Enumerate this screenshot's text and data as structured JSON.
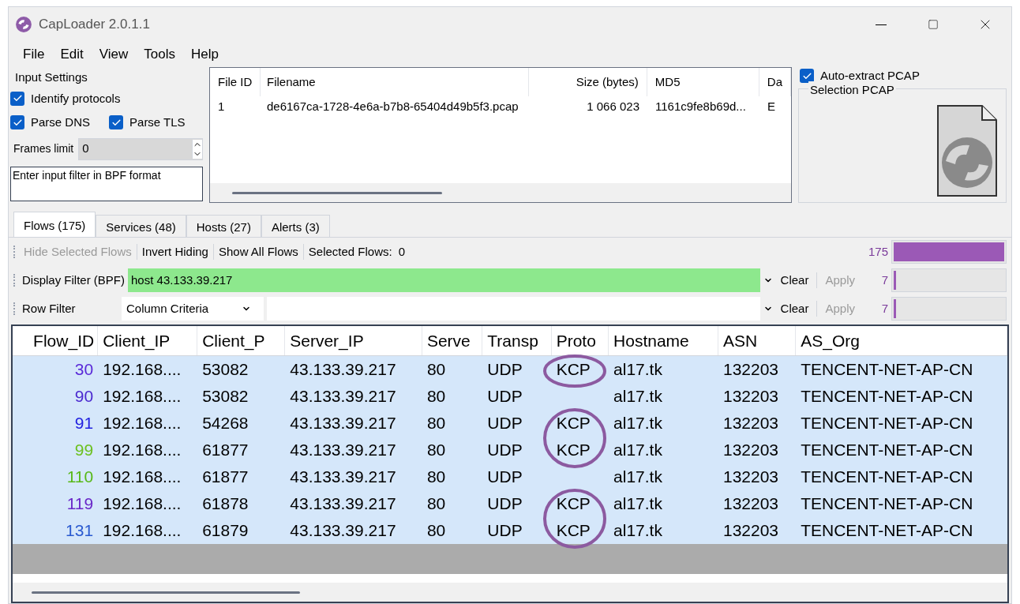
{
  "window": {
    "title": "CapLoader 2.0.1.1"
  },
  "menu": [
    "File",
    "Edit",
    "View",
    "Tools",
    "Help"
  ],
  "input_settings": {
    "title": "Input Settings",
    "checkboxes": [
      {
        "label": "Identify protocols",
        "checked": true
      },
      {
        "label": "Parse DNS",
        "checked": true
      },
      {
        "label": "Parse TLS",
        "checked": true
      }
    ],
    "frames_limit": {
      "label": "Frames limit",
      "value": "0"
    },
    "filter": {
      "placeholder": "Enter input filter in BPF format"
    }
  },
  "files": {
    "columns": [
      "File ID",
      "Filename",
      "Size (bytes)",
      "MD5",
      "Da"
    ],
    "rows": [
      [
        "1",
        "de6167ca-1728-4e6a-b7b8-65404d49b5f3.pcap",
        "1 066 023",
        "1161c9fe8b69d...",
        "E"
      ]
    ]
  },
  "auto_extract": {
    "label": "Auto-extract PCAP",
    "checked": true
  },
  "selection": {
    "title": "Selection PCAP"
  },
  "tabs": [
    {
      "label": "Flows (175)",
      "selected": true
    },
    {
      "label": "Services (48)",
      "selected": false
    },
    {
      "label": "Hosts (27)",
      "selected": false
    },
    {
      "label": "Alerts (3)",
      "selected": false
    }
  ],
  "toolbar": {
    "buttons": [
      {
        "label": "Hide Selected Flows",
        "disabled": true
      },
      {
        "label": "Invert Hiding",
        "disabled": false
      },
      {
        "label": "Show All Flows",
        "disabled": false
      }
    ],
    "selected_label": "Selected Flows:",
    "selected_count": "0",
    "count": "175",
    "level": 1
  },
  "display_filter": {
    "label": "Display Filter (BPF)",
    "value": "host 43.133.39.217",
    "valid": true,
    "clear": "Clear",
    "apply": "Apply",
    "count": "7",
    "level": 0.02
  },
  "row_filter": {
    "label": "Row Filter",
    "criteria": "Column Criteria",
    "clear": "Clear",
    "apply": "Apply",
    "count": "7",
    "level": 0.02
  },
  "table": {
    "columns": [
      "Flow_ID",
      "Client_IP",
      "Client_P",
      "Server_IP",
      "Serve",
      "Transp",
      "Proto",
      "Hostname",
      "ASN",
      "AS_Org"
    ],
    "rows": [
      {
        "selected": true,
        "color": "#5a2ad8",
        "circled": true,
        "cells": [
          "30",
          "192.168....",
          "53082",
          "43.133.39.217",
          "80",
          "UDP",
          "KCP",
          "al17.tk",
          "132203",
          "TENCENT-NET-AP-CN"
        ]
      },
      {
        "selected": true,
        "color": "#4b2ad0",
        "circled": false,
        "cells": [
          "90",
          "192.168....",
          "53082",
          "43.133.39.217",
          "80",
          "UDP",
          "",
          "al17.tk",
          "132203",
          "TENCENT-NET-AP-CN"
        ]
      },
      {
        "selected": true,
        "color": "#2222e0",
        "circled": true,
        "cells": [
          "91",
          "192.168....",
          "54268",
          "43.133.39.217",
          "80",
          "UDP",
          "KCP",
          "al17.tk",
          "132203",
          "TENCENT-NET-AP-CN"
        ]
      },
      {
        "selected": true,
        "color": "#6cc020",
        "circled": true,
        "cells": [
          "99",
          "192.168....",
          "61877",
          "43.133.39.217",
          "80",
          "UDP",
          "KCP",
          "al17.tk",
          "132203",
          "TENCENT-NET-AP-CN"
        ]
      },
      {
        "selected": true,
        "color": "#58b818",
        "circled": false,
        "cells": [
          "110",
          "192.168....",
          "61877",
          "43.133.39.217",
          "80",
          "UDP",
          "",
          "al17.tk",
          "132203",
          "TENCENT-NET-AP-CN"
        ]
      },
      {
        "selected": true,
        "color": "#6a28c8",
        "circled": true,
        "cells": [
          "119",
          "192.168....",
          "61878",
          "43.133.39.217",
          "80",
          "UDP",
          "KCP",
          "al17.tk",
          "132203",
          "TENCENT-NET-AP-CN"
        ]
      },
      {
        "selected": true,
        "color": "#2a5ad0",
        "circled": true,
        "cells": [
          "131",
          "192.168....",
          "61879",
          "43.133.39.217",
          "80",
          "UDP",
          "KCP",
          "al17.tk",
          "132203",
          "TENCENT-NET-AP-CN"
        ]
      }
    ]
  }
}
